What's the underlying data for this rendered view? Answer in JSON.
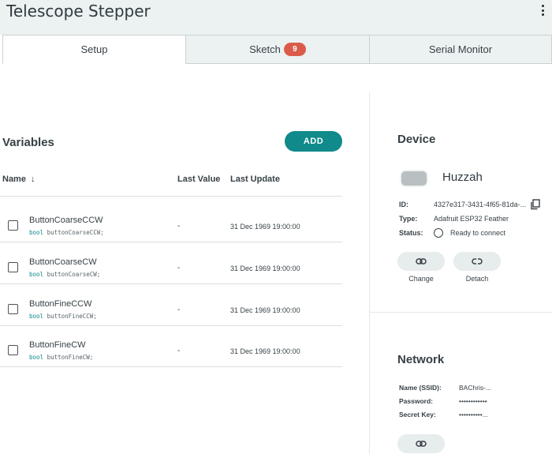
{
  "header": {
    "title": "Telescope Stepper",
    "menu_icon": "kebab-menu-icon"
  },
  "tabs": [
    {
      "label": "Setup",
      "active": true
    },
    {
      "label": "Sketch",
      "badge": "9",
      "active": false
    },
    {
      "label": "Serial Monitor",
      "active": false
    }
  ],
  "variables": {
    "title": "Variables",
    "add_label": "ADD",
    "columns": {
      "name": "Name",
      "last_value": "Last Value",
      "last_update": "Last Update"
    },
    "rows": [
      {
        "name": "ButtonCoarseCCW",
        "type": "bool",
        "decl": "buttonCoarseCCW;",
        "last_value": "-",
        "last_update": "31 Dec 1969 19:00:00"
      },
      {
        "name": "ButtonCoarseCW",
        "type": "bool",
        "decl": "buttonCoarseCW;",
        "last_value": "-",
        "last_update": "31 Dec 1969 19:00:00"
      },
      {
        "name": "ButtonFineCCW",
        "type": "bool",
        "decl": "buttonFineCCW;",
        "last_value": "-",
        "last_update": "31 Dec 1969 19:00:00"
      },
      {
        "name": "ButtonFineCW",
        "type": "bool",
        "decl": "buttonFineCW;",
        "last_value": "-",
        "last_update": "31 Dec 1969 19:00:00"
      }
    ]
  },
  "device": {
    "title": "Device",
    "name": "Huzzah",
    "id_label": "ID:",
    "id_value": "4327e317-3431-4f65-81da-...",
    "type_label": "Type:",
    "type_value": "Adafruit ESP32 Feather",
    "status_label": "Status:",
    "status_value": "Ready to connect",
    "change_label": "Change",
    "detach_label": "Detach"
  },
  "network": {
    "title": "Network",
    "ssid_label": "Name (SSID):",
    "ssid_value": "BAChris-...",
    "password_label": "Password:",
    "password_value": "••••••••••••",
    "secret_label": "Secret Key:",
    "secret_value": "••••••••••..."
  },
  "colors": {
    "accent": "#108a8a",
    "badge": "#da5b4a",
    "topbar": "#ecf1f1"
  }
}
